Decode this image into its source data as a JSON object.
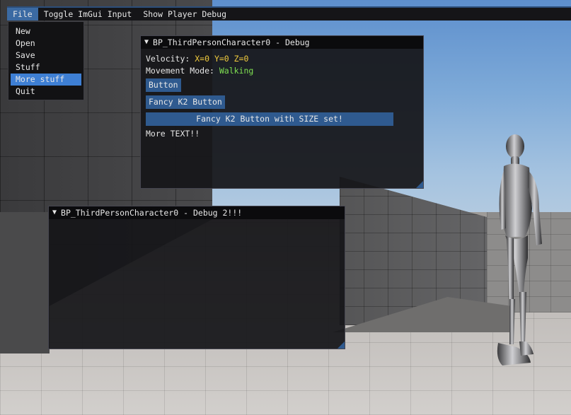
{
  "menubar": {
    "items": [
      "File",
      "Toggle ImGui Input",
      "Show Player Debug"
    ]
  },
  "file_menu": {
    "items": [
      "New",
      "Open",
      "Save",
      "Stuff",
      "More stuff",
      "Quit"
    ],
    "hovered": "More stuff"
  },
  "debug_window": {
    "title": "BP_ThirdPersonCharacter0 - Debug",
    "velocity_label": "Velocity: ",
    "velocity_value": "X=0 Y=0 Z=0",
    "movement_label": "Movement Mode: ",
    "movement_value": "Walking",
    "button_label": "Button",
    "fancy_button_label": "Fancy K2 Button",
    "sized_button_label": "Fancy K2 Button with SIZE set!",
    "more_text": "More TEXT!!"
  },
  "debug_window_2": {
    "title": "BP_ThirdPersonCharacter0 - Debug 2!!!"
  },
  "icons": {
    "collapse": "triangle-down-icon",
    "resize": "resize-grip-icon"
  },
  "colors": {
    "menubar_accent": "#2c4e7a",
    "button": "#2f5a8f",
    "hover": "#3e7fd4",
    "value_yellow": "#f2cc3d",
    "value_green": "#7fe052"
  }
}
